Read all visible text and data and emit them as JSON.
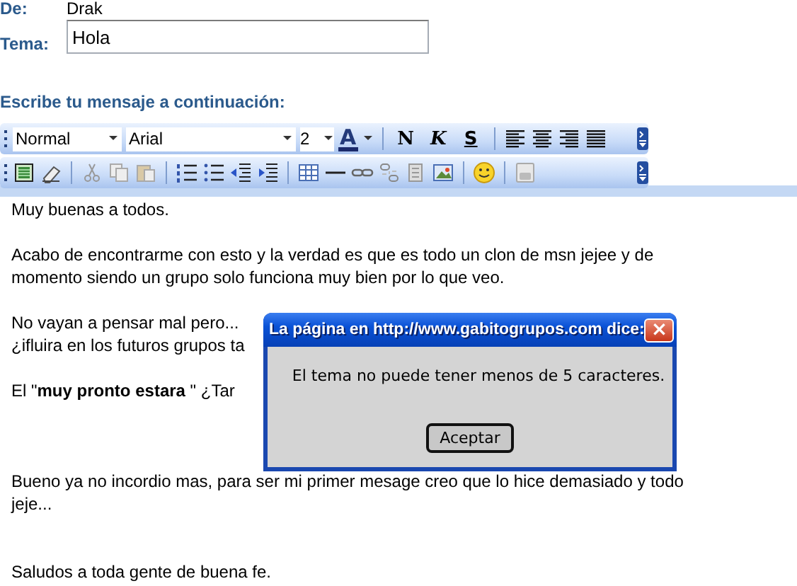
{
  "form": {
    "from_label": "De:",
    "from_value": "Drak",
    "subject_label": "Tema:",
    "subject_value": "Hola",
    "message_label": "Escribe tu mensaje a continuación:"
  },
  "toolbar": {
    "style_select": "Normal",
    "font_select": "Arial",
    "size_select": "2",
    "font_color": "A",
    "bold": "N",
    "italic": "K",
    "underline": "S"
  },
  "editor": {
    "paragraphs": [
      [
        "Muy buenas a todos."
      ],
      [
        "Acabo de encontrarme con esto y la verdad es que es todo un clon de msn jejee y de",
        "momento siendo un grupo solo funciona muy bien por lo que veo."
      ],
      [
        "No vayan a pensar mal pero...",
        "¿ifluira en los futuros grupos ta"
      ],
      [
        "El \"**muy pronto estara** \" ¿Tar"
      ],
      [
        "Bueno ya no incordio mas, para ser mi primer mesage creo que lo hice demasiado y todo",
        "jeje..."
      ],
      [
        "Saludos a toda gente de buena fe."
      ]
    ]
  },
  "dialog": {
    "title": "La página en http://www.gabitogrupos.com dice:",
    "close": "×",
    "message": "El tema no puede tener menos de 5 caracteres.",
    "button": "Aceptar"
  }
}
